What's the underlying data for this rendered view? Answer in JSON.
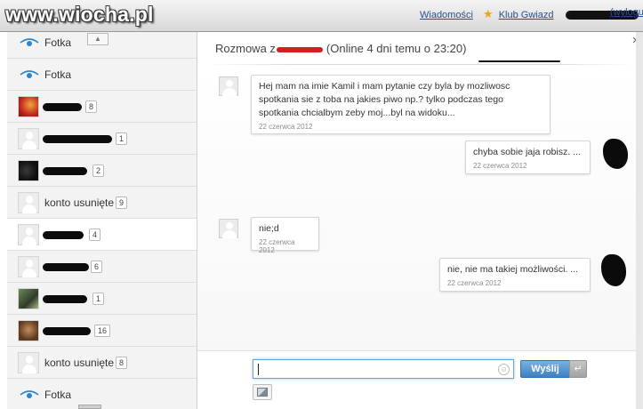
{
  "site": {
    "logo": "www.wiocha.pl"
  },
  "topnav": {
    "messages": "Wiadomości",
    "star_club": "Klub Gwiazd",
    "logout": "(wylogu"
  },
  "sidebar": {
    "contacts": [
      {
        "type": "photo",
        "name": "Fotka",
        "count": null
      },
      {
        "type": "photo",
        "name": "Fotka",
        "count": null
      },
      {
        "type": "user",
        "name": "",
        "count": "8"
      },
      {
        "type": "user",
        "name": "",
        "count": "1"
      },
      {
        "type": "user",
        "name": "",
        "count": "2"
      },
      {
        "type": "deleted",
        "name": "konto usunięte",
        "count": "9"
      },
      {
        "type": "user",
        "name": "",
        "count": "4",
        "active": true
      },
      {
        "type": "user",
        "name": "",
        "count": "6"
      },
      {
        "type": "user",
        "name": "",
        "count": "1"
      },
      {
        "type": "user",
        "name": "",
        "count": "16"
      },
      {
        "type": "deleted",
        "name": "konto usunięte",
        "count": "8"
      },
      {
        "type": "photo",
        "name": "Fotka",
        "count": null
      }
    ]
  },
  "chat": {
    "header_prefix": "Rozmowa z",
    "header_status": "(Online 4 dni temu o 23:20)",
    "messages": [
      {
        "side": "left",
        "text": "Hej mam na imie Kamil i mam pytanie czy byla by mozliwosc spotkania sie z toba na jakies piwo np.? tylko podczas tego spotkania chcialbym zeby moj...byl na widoku...",
        "date": "22 czerwca 2012"
      },
      {
        "side": "right",
        "text": "chyba sobie jaja robisz. ...",
        "date": "22 czerwca 2012"
      },
      {
        "side": "left",
        "text": "nie;d",
        "date": "22 czerwca 2012"
      },
      {
        "side": "right",
        "text": "nie, nie ma takiej możliwości. ...",
        "date": "22 czerwca 2012"
      }
    ],
    "input": {
      "value": "",
      "placeholder": ""
    },
    "send_label": "Wyślij",
    "enter_icon": "↵"
  },
  "icons": {
    "eye": "eye-icon",
    "close": "close-icon",
    "smiley": "smiley-icon",
    "image": "image-icon",
    "star": "star-icon"
  },
  "colors": {
    "accent": "#3d80c4",
    "link": "#2a4f8f",
    "eye": "#2f86c8"
  }
}
